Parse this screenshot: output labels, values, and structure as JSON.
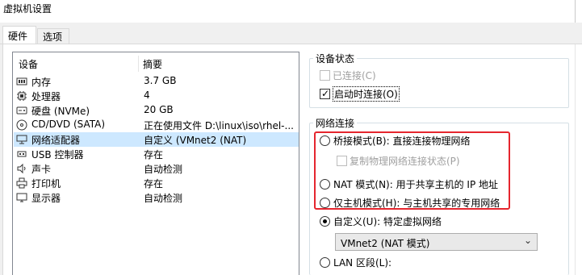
{
  "window": {
    "title": "虚拟机设置"
  },
  "tabs": [
    {
      "label": "硬件",
      "active": true
    },
    {
      "label": "选项",
      "active": false
    }
  ],
  "device_list": {
    "headers": {
      "device": "设备",
      "summary": "摘要"
    },
    "rows": [
      {
        "icon": "memory-icon",
        "name": "内存",
        "summary": "3.7 GB",
        "selected": false
      },
      {
        "icon": "processor-icon",
        "name": "处理器",
        "summary": "4",
        "selected": false
      },
      {
        "icon": "harddisk-icon",
        "name": "硬盘 (NVMe)",
        "summary": "20 GB",
        "selected": false
      },
      {
        "icon": "cdrom-icon",
        "name": "CD/DVD (SATA)",
        "summary": "正在使用文件 D:\\linux\\iso\\rhel-...",
        "selected": false
      },
      {
        "icon": "network-adapter-icon",
        "name": "网络适配器",
        "summary": "自定义 (VMnet2 (NAT)",
        "selected": true
      },
      {
        "icon": "usb-icon",
        "name": "USB 控制器",
        "summary": "存在",
        "selected": false
      },
      {
        "icon": "sound-icon",
        "name": "声卡",
        "summary": "自动检测",
        "selected": false
      },
      {
        "icon": "printer-icon",
        "name": "打印机",
        "summary": "存在",
        "selected": false
      },
      {
        "icon": "display-icon",
        "name": "显示器",
        "summary": "自动检测",
        "selected": false
      }
    ]
  },
  "device_status": {
    "title": "设备状态",
    "connected": {
      "label": "已连接(C)",
      "checked": false,
      "enabled": false
    },
    "connect_on_power": {
      "label": "启动时连接(O)",
      "checked": true,
      "enabled": true
    }
  },
  "network": {
    "title": "网络连接",
    "bridged": {
      "label": "桥接模式(B): 直接连接物理网络",
      "selected": false
    },
    "replicate": {
      "label": "复制物理网络连接状态(P)",
      "checked": false,
      "enabled": false
    },
    "nat": {
      "label": "NAT 模式(N): 用于共享主机的 IP 地址",
      "selected": false
    },
    "host_only": {
      "label": "仅主机模式(H): 与主机共享的专用网络",
      "selected": false
    },
    "custom": {
      "label": "自定义(U): 特定虚拟网络",
      "selected": true
    },
    "custom_select": {
      "value": "VMnet2 (NAT 模式)"
    },
    "lan": {
      "label": "LAN 区段(L):",
      "selected": false
    }
  },
  "highlight_color": "#e5262e",
  "selection_color": "#cde8ff"
}
